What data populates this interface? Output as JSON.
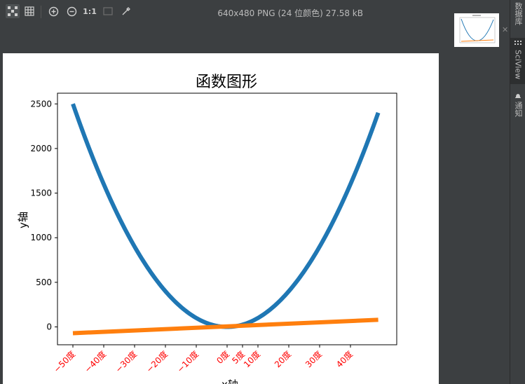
{
  "toolbar": {
    "zoom_actual_label": "1:1",
    "image_info": "640x480 PNG (24 位颜色) 27.58 kB",
    "icons": [
      "chessboard-icon",
      "grid-icon",
      "zoom-in-icon",
      "zoom-out-icon",
      "actual-size-icon",
      "fit-icon",
      "color-picker-icon"
    ]
  },
  "right_panel": {
    "tabs": [
      {
        "label": "数据库",
        "icon": "database-icon"
      },
      {
        "label": "SciView",
        "icon": "sciview-icon"
      },
      {
        "label": "通知",
        "icon": "bell-icon"
      }
    ]
  },
  "colors": {
    "series1": "#1f77b4",
    "series2": "#ff7f0e",
    "tick_label_red": "#ff0000"
  },
  "chart_data": {
    "type": "line",
    "title": "函数图形",
    "xlabel": "x轴",
    "ylabel": "y轴",
    "xlim": [
      -55,
      55
    ],
    "ylim": [
      -200,
      2620
    ],
    "yticks": [
      0,
      500,
      1000,
      1500,
      2000,
      2500
    ],
    "xticks": [
      -50,
      -40,
      -30,
      -20,
      -10,
      0,
      5,
      10,
      20,
      30,
      40
    ],
    "xtick_labels": [
      "−50度",
      "−40度",
      "−30度",
      "−20度",
      "−10度",
      "0度",
      "5度",
      "10度",
      "20度",
      "30度",
      "40度"
    ],
    "series": [
      {
        "x": [
          -50,
          -40,
          -30,
          -20,
          -10,
          0,
          10,
          20,
          30,
          49
        ],
        "y": [
          2500,
          1600,
          900,
          400,
          100,
          0,
          100,
          400,
          900,
          2401
        ]
      },
      {
        "x": [
          -50,
          49
        ],
        "y": [
          -70,
          80
        ]
      }
    ]
  }
}
